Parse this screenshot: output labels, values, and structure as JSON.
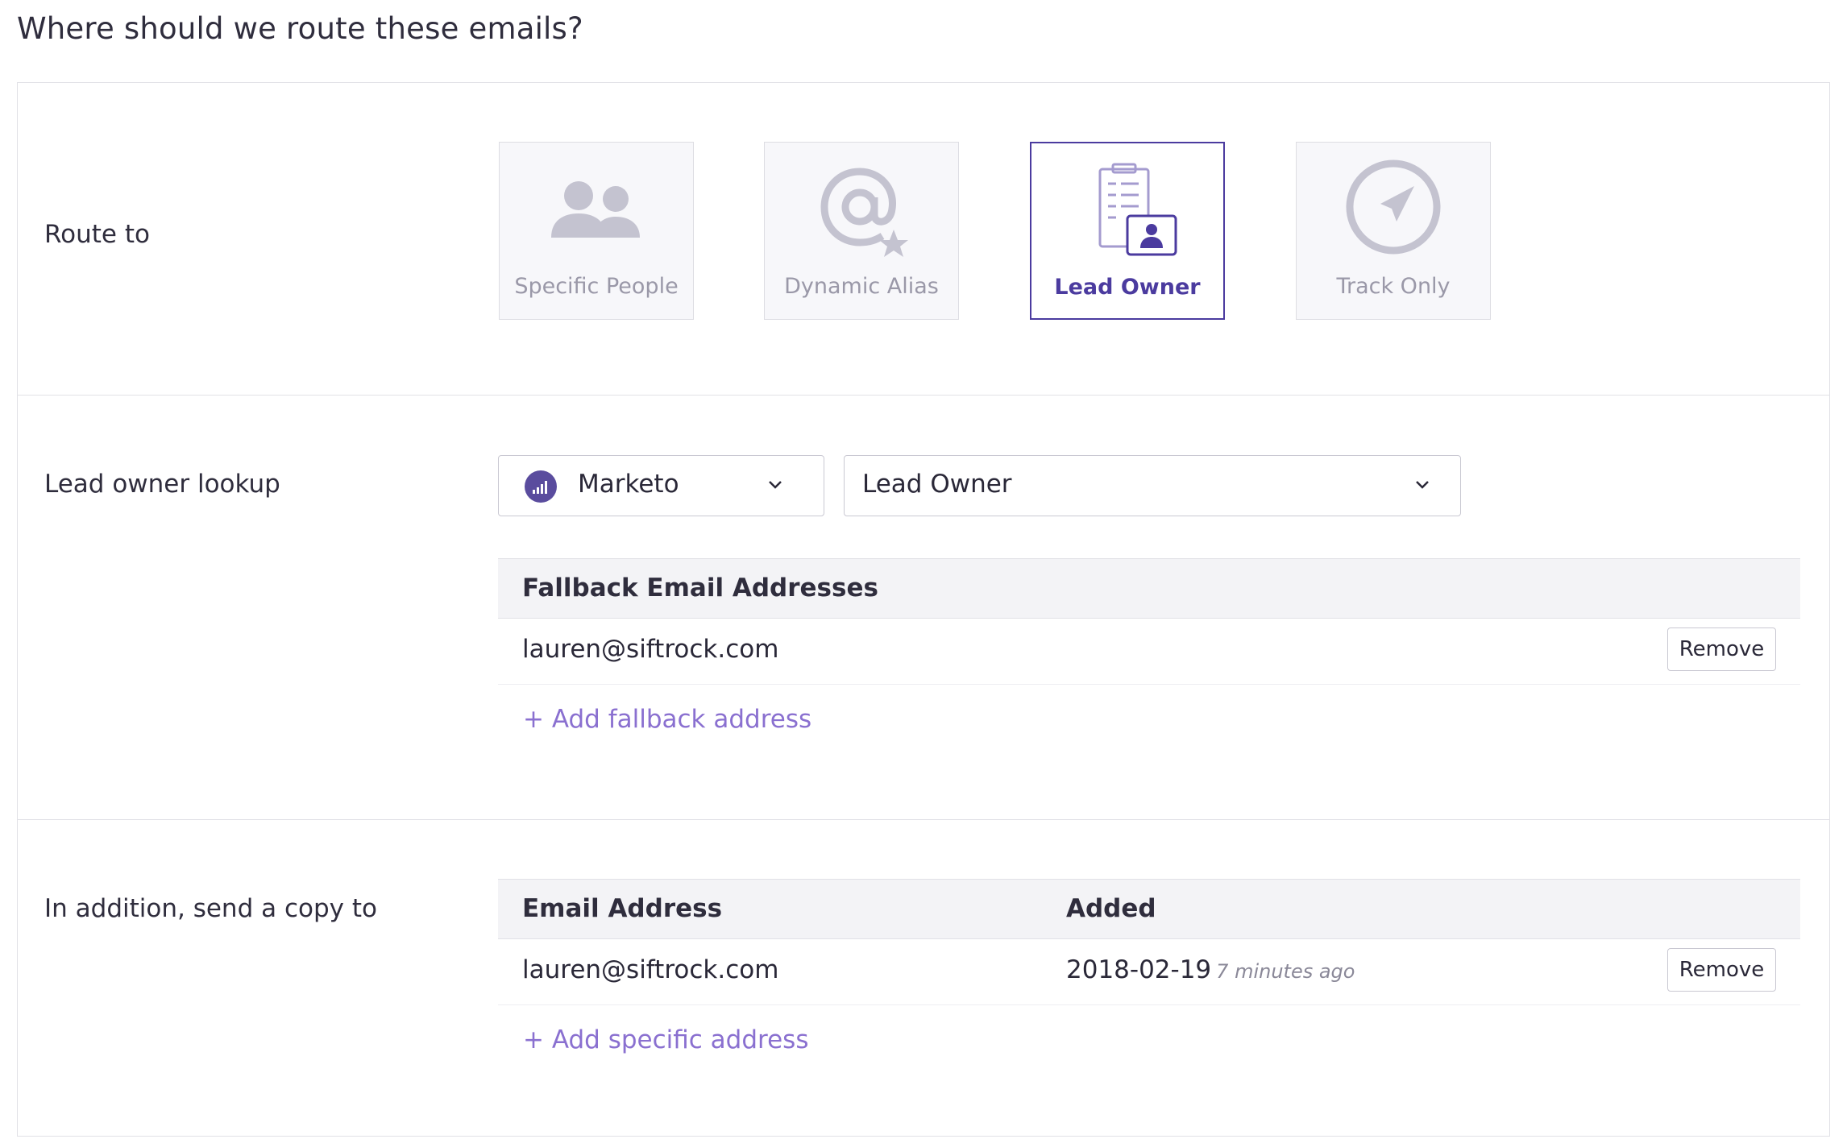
{
  "heading": "Where should we route these emails?",
  "route": {
    "label": "Route to",
    "options": [
      {
        "label": "Specific People",
        "icon": "people-icon",
        "selected": false
      },
      {
        "label": "Dynamic Alias",
        "icon": "at-star-icon",
        "selected": false
      },
      {
        "label": "Lead Owner",
        "icon": "clipboard-person-icon",
        "selected": true
      },
      {
        "label": "Track Only",
        "icon": "navigation-arrow-icon",
        "selected": false
      }
    ]
  },
  "lookup": {
    "label": "Lead owner lookup",
    "source_select": {
      "value": "Marketo",
      "icon": "marketo-logo-icon"
    },
    "field_select": {
      "value": "Lead Owner"
    },
    "fallback_table": {
      "header": "Fallback Email Addresses",
      "rows": [
        {
          "email": "lauren@siftrock.com",
          "action": "Remove"
        }
      ],
      "add_link": "+ Add fallback address"
    }
  },
  "copy": {
    "label": "In addition, send a copy to",
    "table": {
      "headers": [
        "Email Address",
        "Added"
      ],
      "rows": [
        {
          "email": "lauren@siftrock.com",
          "date": "2018-02-19",
          "relative": "7 minutes ago",
          "action": "Remove"
        }
      ],
      "add_link": "+ Add specific address"
    }
  },
  "colors": {
    "accent": "#4b3b9f",
    "link": "#8a70d0",
    "muted_icon": "#c4c3d0"
  }
}
